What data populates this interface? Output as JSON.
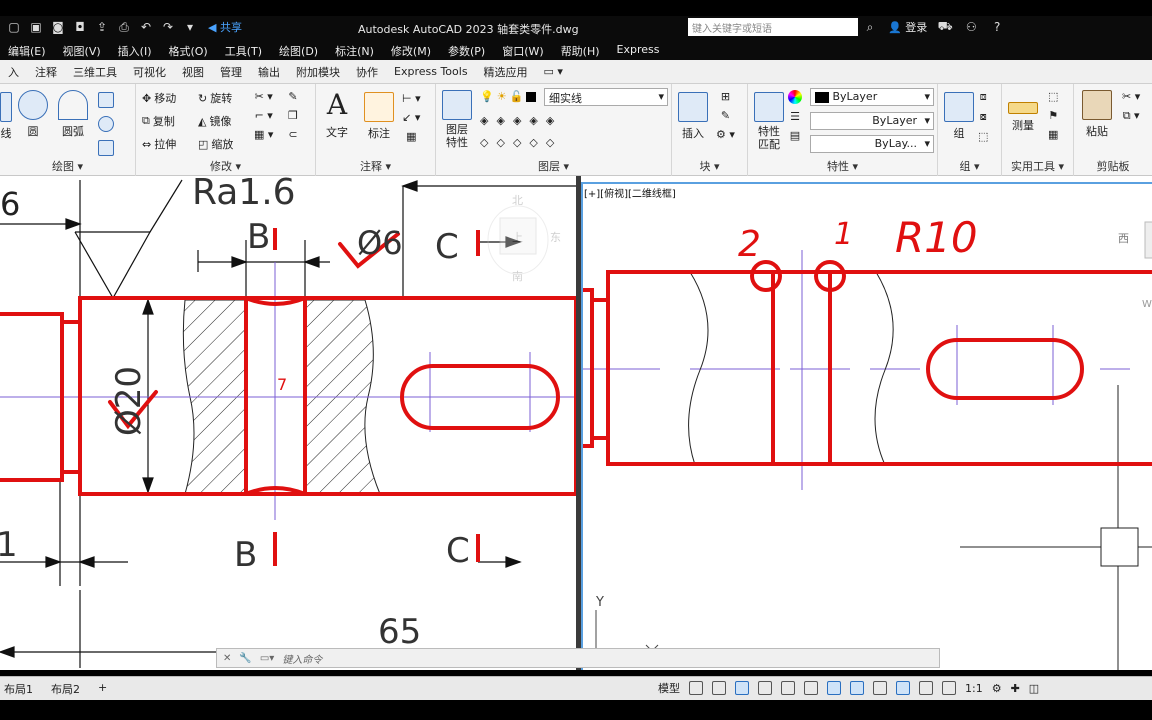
{
  "titlebar": {
    "share": "共享",
    "title": "Autodesk AutoCAD 2023    轴套类零件.dwg",
    "search_placeholder": "键入关键字或短语",
    "login": "登录"
  },
  "menu": [
    "编辑(E)",
    "视图(V)",
    "插入(I)",
    "格式(O)",
    "工具(T)",
    "绘图(D)",
    "标注(N)",
    "修改(M)",
    "参数(P)",
    "窗口(W)",
    "帮助(H)",
    "Express"
  ],
  "tabs": [
    "入",
    "注释",
    "三维工具",
    "可视化",
    "视图",
    "管理",
    "输出",
    "附加模块",
    "协作",
    "Express Tools",
    "精选应用"
  ],
  "ribbon": {
    "draw": {
      "title": "绘图",
      "line": "线",
      "circle": "圆",
      "arc": "圆弧"
    },
    "modify": {
      "title": "修改",
      "move": "移动",
      "rotate": "旋转",
      "copy": "复制",
      "mirror": "镜像",
      "stretch": "拉伸",
      "scale": "缩放"
    },
    "annotation": {
      "title": "注释",
      "text": "文字",
      "dimension": "标注"
    },
    "layers": {
      "title": "图层",
      "layer_props": "图层\n特性",
      "layer_name": "细实线"
    },
    "block": {
      "title": "块",
      "insert": "插入"
    },
    "properties": {
      "title": "特性",
      "match": "特性\n匹配",
      "color": "ByLayer",
      "linetype": "ByLayer",
      "lineweight": "ByLay..."
    },
    "groups": {
      "title": "组",
      "group": "组"
    },
    "utilities": {
      "title": "实用工具",
      "measure": "测量"
    },
    "clipboard": {
      "title": "剪贴板",
      "paste": "粘贴"
    }
  },
  "viewport_left": {
    "dim_roughness": "Ra1.6",
    "dim_6": "6",
    "section_b_top": "B",
    "section_b_bottom": "B",
    "section_c_top": "C",
    "section_c_bottom": "C",
    "dim_phi6": "Ø6",
    "dim_phi20": "Ø20",
    "dim_65": "65",
    "dim_1": "1",
    "viewcube_north": "北",
    "viewcube_top": "上",
    "viewcube_east": "东",
    "viewcube_south": "南",
    "mark_7": "7"
  },
  "viewport_right": {
    "label": "[+][俯视][二维线框]",
    "mark_2": "2",
    "mark_1": "1",
    "radius": "R10",
    "viewcube_west": "西",
    "ucs_y": "Y",
    "w_label": "W"
  },
  "commandline": {
    "placeholder": "键入命令"
  },
  "statusbar": {
    "layout1": "布局1",
    "layout2": "布局2",
    "add": "+",
    "model": "模型",
    "scale": "1:1"
  },
  "colors": {
    "red_mark": "#e01010",
    "center_line": "#7b5fd6",
    "viewport_border": "#5aa0e0"
  }
}
